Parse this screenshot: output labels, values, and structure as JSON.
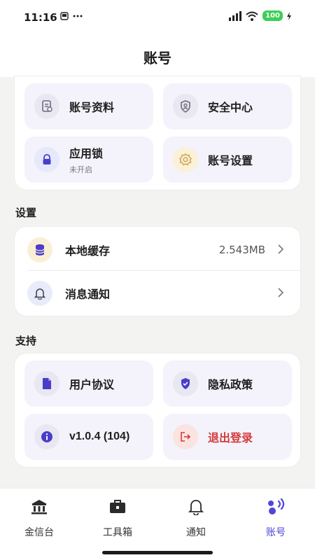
{
  "status": {
    "time": "11:16",
    "battery": "100"
  },
  "header": {
    "title": "账号"
  },
  "account_tiles": [
    {
      "label": "账号资料"
    },
    {
      "label": "安全中心"
    },
    {
      "label": "应用锁",
      "sub": "未开启"
    },
    {
      "label": "账号设置"
    }
  ],
  "settings": {
    "section_title": "设置",
    "items": [
      {
        "label": "本地缓存",
        "value": "2.543MB"
      },
      {
        "label": "消息通知"
      }
    ]
  },
  "support": {
    "section_title": "支持",
    "tiles": [
      {
        "label": "用户协议"
      },
      {
        "label": "隐私政策"
      },
      {
        "label": "v1.0.4 (104)"
      },
      {
        "label": "退出登录"
      }
    ]
  },
  "tabbar": {
    "items": [
      {
        "label": "金信台",
        "icon": "bank-icon"
      },
      {
        "label": "工具箱",
        "icon": "toolbox-icon"
      },
      {
        "label": "通知",
        "icon": "bell-icon"
      },
      {
        "label": "账号",
        "icon": "account-icon"
      }
    ],
    "active": "账号"
  },
  "colors": {
    "accent": "#5046d8",
    "danger": "#d43b3b",
    "tile_bg": "#f4f3fb",
    "page_bg": "#f3f3f1"
  }
}
